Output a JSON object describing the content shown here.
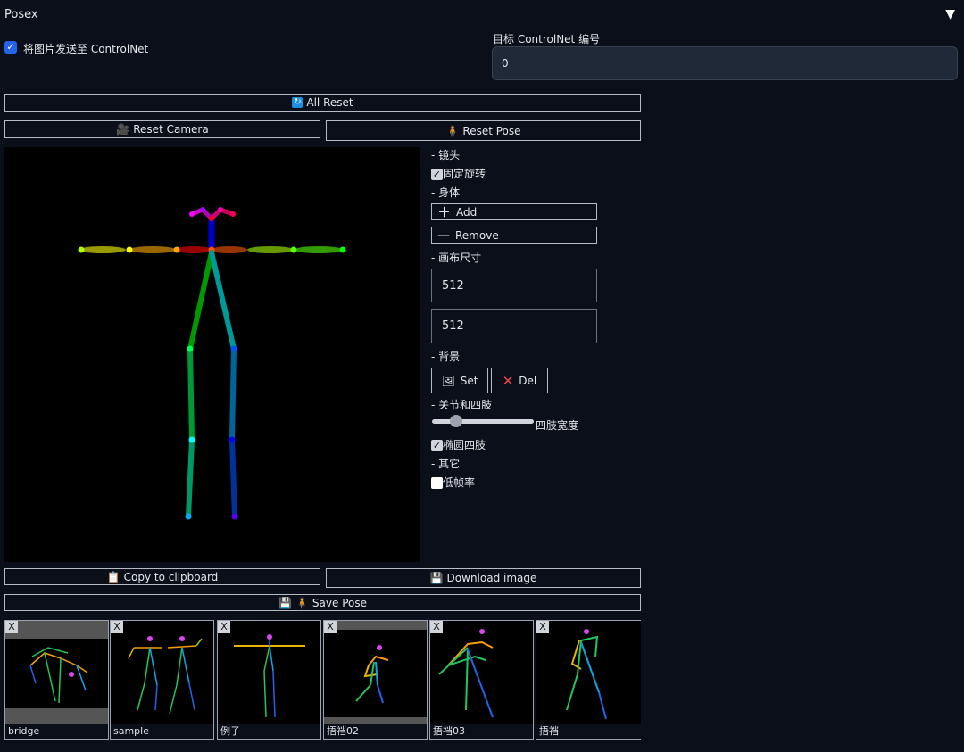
{
  "panel": {
    "title": "Posex",
    "collapse_icon": "▼"
  },
  "send_to_controlnet": {
    "label": "将图片发送至 ControlNet",
    "checked": true
  },
  "target": {
    "label": "目标 ControlNet 编号",
    "value": "0"
  },
  "buttons": {
    "all_reset": "All Reset",
    "reset_camera": "Reset Camera",
    "reset_pose": "Reset Pose",
    "copy_clipboard": "Copy to clipboard",
    "download_image": "Download image",
    "save_pose": "Save Pose"
  },
  "side": {
    "camera_label": "- 镜头",
    "fix_rotation": "固定旋转",
    "body_label": "- 身体",
    "add": "Add",
    "remove": "Remove",
    "canvas_size_label": "- 画布尺寸",
    "width": "512",
    "height": "512",
    "background_label": "- 背景",
    "set": "Set",
    "del": "Del",
    "joints_label": "- 关节和四肢",
    "limb_width_label": "四肢宽度",
    "limb_width_value": 0.2,
    "ellipse_limbs": "椭圆四肢",
    "other_label": "- 其它",
    "low_fps": "低帧率"
  },
  "thumbnails": [
    {
      "name": "bridge"
    },
    {
      "name": "sample"
    },
    {
      "name": "例子"
    },
    {
      "name": "捂裆02"
    },
    {
      "name": "捂裆03"
    },
    {
      "name": "捂裆"
    }
  ],
  "thumb_close": "X"
}
